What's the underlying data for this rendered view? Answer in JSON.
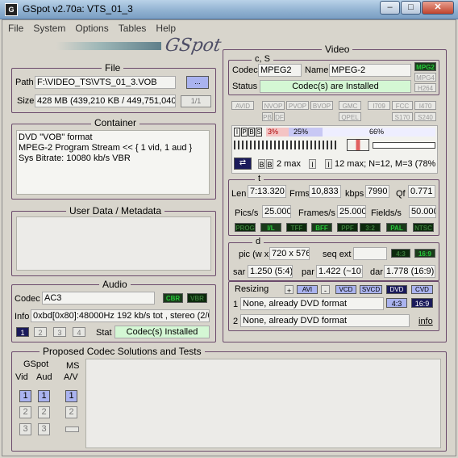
{
  "window": {
    "icon": "G",
    "title": "GSpot v2.70a: VTS_01_3",
    "min": "–",
    "max": "□",
    "close": "✕"
  },
  "menu": [
    "File",
    "System",
    "Options",
    "Tables",
    "Help"
  ],
  "logo": "GSpot",
  "file": {
    "title": "File",
    "path_label": "Path",
    "path": "F:\\VIDEO_TS\\VTS_01_3.VOB",
    "browse": "...",
    "size_label": "Size",
    "size": "428 MB (439,210 KB / 449,751,040",
    "page": "1/1"
  },
  "container": {
    "title": "Container",
    "lines": [
      "DVD \"VOB\" format",
      "MPEG-2 Program Stream << { 1 vid, 1 aud }",
      "Sys Bitrate: 10080 kb/s VBR"
    ]
  },
  "userdata": {
    "title": "User Data / Metadata"
  },
  "audio": {
    "title": "Audio",
    "codec_label": "Codec",
    "codec": "AC3",
    "cbr": "CBR",
    "vbr": "VBR",
    "info_label": "Info",
    "info": "0xbd[0x80]:48000Hz  192 kb/s tot , stereo (2/0",
    "tabs": [
      "1",
      "2",
      "3",
      "4"
    ],
    "stat_label": "Stat",
    "stat": "Codec(s) Installed"
  },
  "proposed": {
    "title": "Proposed Codec Solutions and Tests",
    "gspot": "GSpot",
    "vid": "Vid",
    "aud": "Aud",
    "ms": "MS",
    "av": "A/V",
    "nums": [
      "1",
      "2",
      "3"
    ]
  },
  "video": {
    "title": "Video",
    "cs": "c, S",
    "codec_label": "Codec",
    "codec": "MPEG2",
    "name_label": "Name",
    "name": "MPEG-2",
    "f_mpg2": "MPG2",
    "f_mpg4": "MPG4",
    "f_h264": "H264",
    "status_label": "Status",
    "status": "Codec(s) are Installed",
    "row1": [
      "AVID",
      "NVOP",
      "PVOP",
      "BVOP",
      "GMC",
      "I709",
      "FCC",
      "I470"
    ],
    "row2": [
      "PB",
      "DF",
      "QPEL",
      "S170",
      "S240"
    ],
    "ipbs": [
      "I",
      "P",
      "B",
      "S"
    ],
    "pct1": "3%",
    "pct2": "25%",
    "pct3": "66%",
    "max1": "2 max",
    "max2": "12 max; N=12, M=3 (78%",
    "t": "t",
    "len_label": "Len",
    "len": "7:13.320",
    "frms_label": "Frms",
    "frms": "10,833",
    "kbps_label": "kbps",
    "kbps": "7990",
    "qf_label": "Qf",
    "qf": "0.771",
    "pics_label": "Pics/s",
    "pics": "25.000",
    "frames_label": "Frames/s",
    "frames": "25.000",
    "fields_label": "Fields/s",
    "fields": "50.000",
    "flags2": [
      "PROG",
      "I/L",
      "TFF",
      "BFF",
      "PPF",
      "3:2",
      "PAL",
      "NTSC"
    ],
    "d": "d",
    "pic_label": "pic (w x",
    "pic": "720 x 576",
    "seqext_label": "seq ext",
    "r43": "4:3",
    "r169": "16:9",
    "sar_label": "sar",
    "sar": "1.250 (5:4)",
    "par_label": "par",
    "par": "1.422 (~10:",
    "dar_label": "dar",
    "dar": "1.778 (16:9)",
    "resizing_label": "Resizing",
    "plus": "+",
    "avi": "AVI",
    "minus": "-",
    "vcd": "VCD",
    "svcd": "SVCD",
    "dvd": "DVD",
    "cvd": "CVD",
    "r1_label": "1",
    "r1": "None, already DVD format",
    "b43": "4:3",
    "b169": "16:9",
    "r2_label": "2",
    "r2": "None, already DVD format",
    "info": "info"
  }
}
